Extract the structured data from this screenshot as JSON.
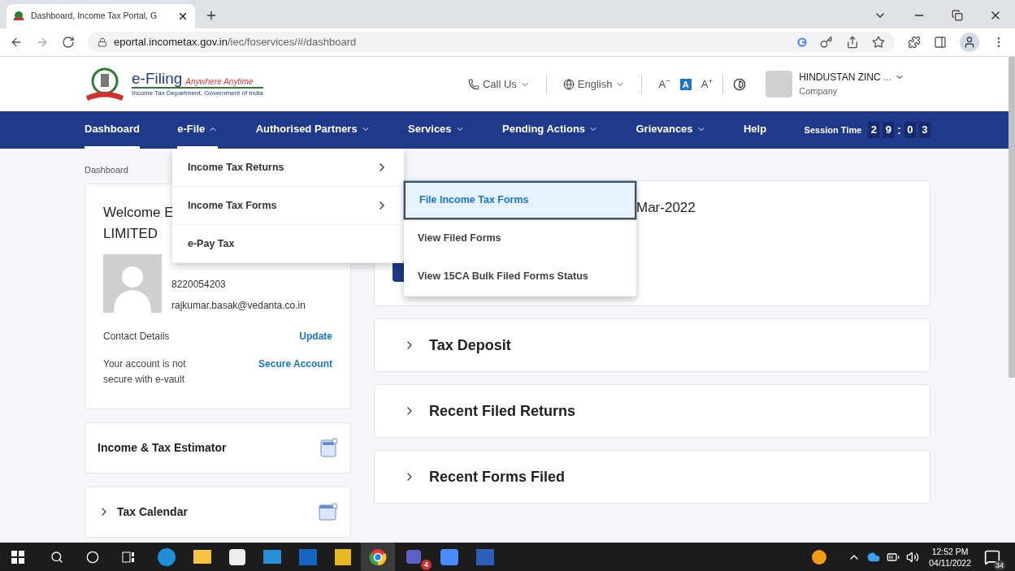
{
  "browser": {
    "tab_title": "Dashboard, Income Tax Portal, G",
    "url_domain": "eportal.incometax.gov.in",
    "url_path": "/iec/foservices/#/dashboard"
  },
  "header": {
    "brand": "e-Filing",
    "tagline": "Anywhere Anytime",
    "department": "Income Tax Department, Government of India",
    "call_us": "Call Us",
    "language": "English",
    "font_sizes": [
      {
        "label": "A",
        "sup": "−",
        "selected": false
      },
      {
        "label": "A",
        "selected": true
      },
      {
        "label": "A",
        "sup": "+",
        "selected": false
      }
    ],
    "user_name": "HINDUSTAN ZINC",
    "user_ellipsis": "...",
    "user_role": "Company"
  },
  "nav": {
    "items": [
      {
        "label": "Dashboard",
        "kind": "link",
        "selected": true
      },
      {
        "label": "e-File",
        "kind": "dropdown",
        "selected": true,
        "expanded": true
      },
      {
        "label": "Authorised Partners",
        "kind": "dropdown",
        "selected": false,
        "expanded": false
      },
      {
        "label": "Services",
        "kind": "dropdown",
        "selected": false,
        "expanded": false
      },
      {
        "label": "Pending Actions",
        "kind": "dropdown",
        "selected": false,
        "expanded": false
      },
      {
        "label": "Grievances",
        "kind": "dropdown",
        "selected": false,
        "expanded": false
      },
      {
        "label": "Help",
        "kind": "link",
        "selected": false
      }
    ],
    "session_label": "Session Time",
    "session_digits": [
      "2",
      "9",
      ":",
      "0",
      "3"
    ]
  },
  "efile_menu": {
    "items": [
      {
        "label": "Income Tax Returns",
        "has_submenu": true
      },
      {
        "label": "Income Tax Forms",
        "has_submenu": true
      },
      {
        "label": "e-Pay Tax",
        "has_submenu": false
      }
    ],
    "submenu": [
      {
        "label": "File Income Tax Forms",
        "selected": true
      },
      {
        "label": "View Filed Forms",
        "selected": false
      },
      {
        "label": "View 15CA Bulk Filed Forms Status",
        "selected": false
      }
    ]
  },
  "breadcrumb": "Dashboard",
  "profile_card": {
    "welcome_line1": "Welcome E",
    "welcome_line2": "LIMITED",
    "phone": "8220054203",
    "email": "rajkumar.basak@vedanta.co.in",
    "contact_label": "Contact Details",
    "contact_link": "Update",
    "secure_text": "Your account is not secure with e-vault",
    "secure_link": "Secure Account"
  },
  "side_cards": [
    {
      "label": "Income & Tax Estimator",
      "kind": "estimator",
      "expandable": false
    },
    {
      "label": "Tax Calendar",
      "kind": "calendar",
      "expandable": true
    }
  ],
  "filing_card": {
    "title_fragment": "Mar-2022"
  },
  "accordions": [
    {
      "label": "Tax Deposit",
      "expanded": false
    },
    {
      "label": "Recent Filed Returns",
      "expanded": false
    },
    {
      "label": "Recent Forms Filed",
      "expanded": false
    }
  ],
  "taskbar": {
    "teams_badge": "4",
    "time": "12:52 PM",
    "date": "04/11/2022",
    "notifications": "34"
  }
}
